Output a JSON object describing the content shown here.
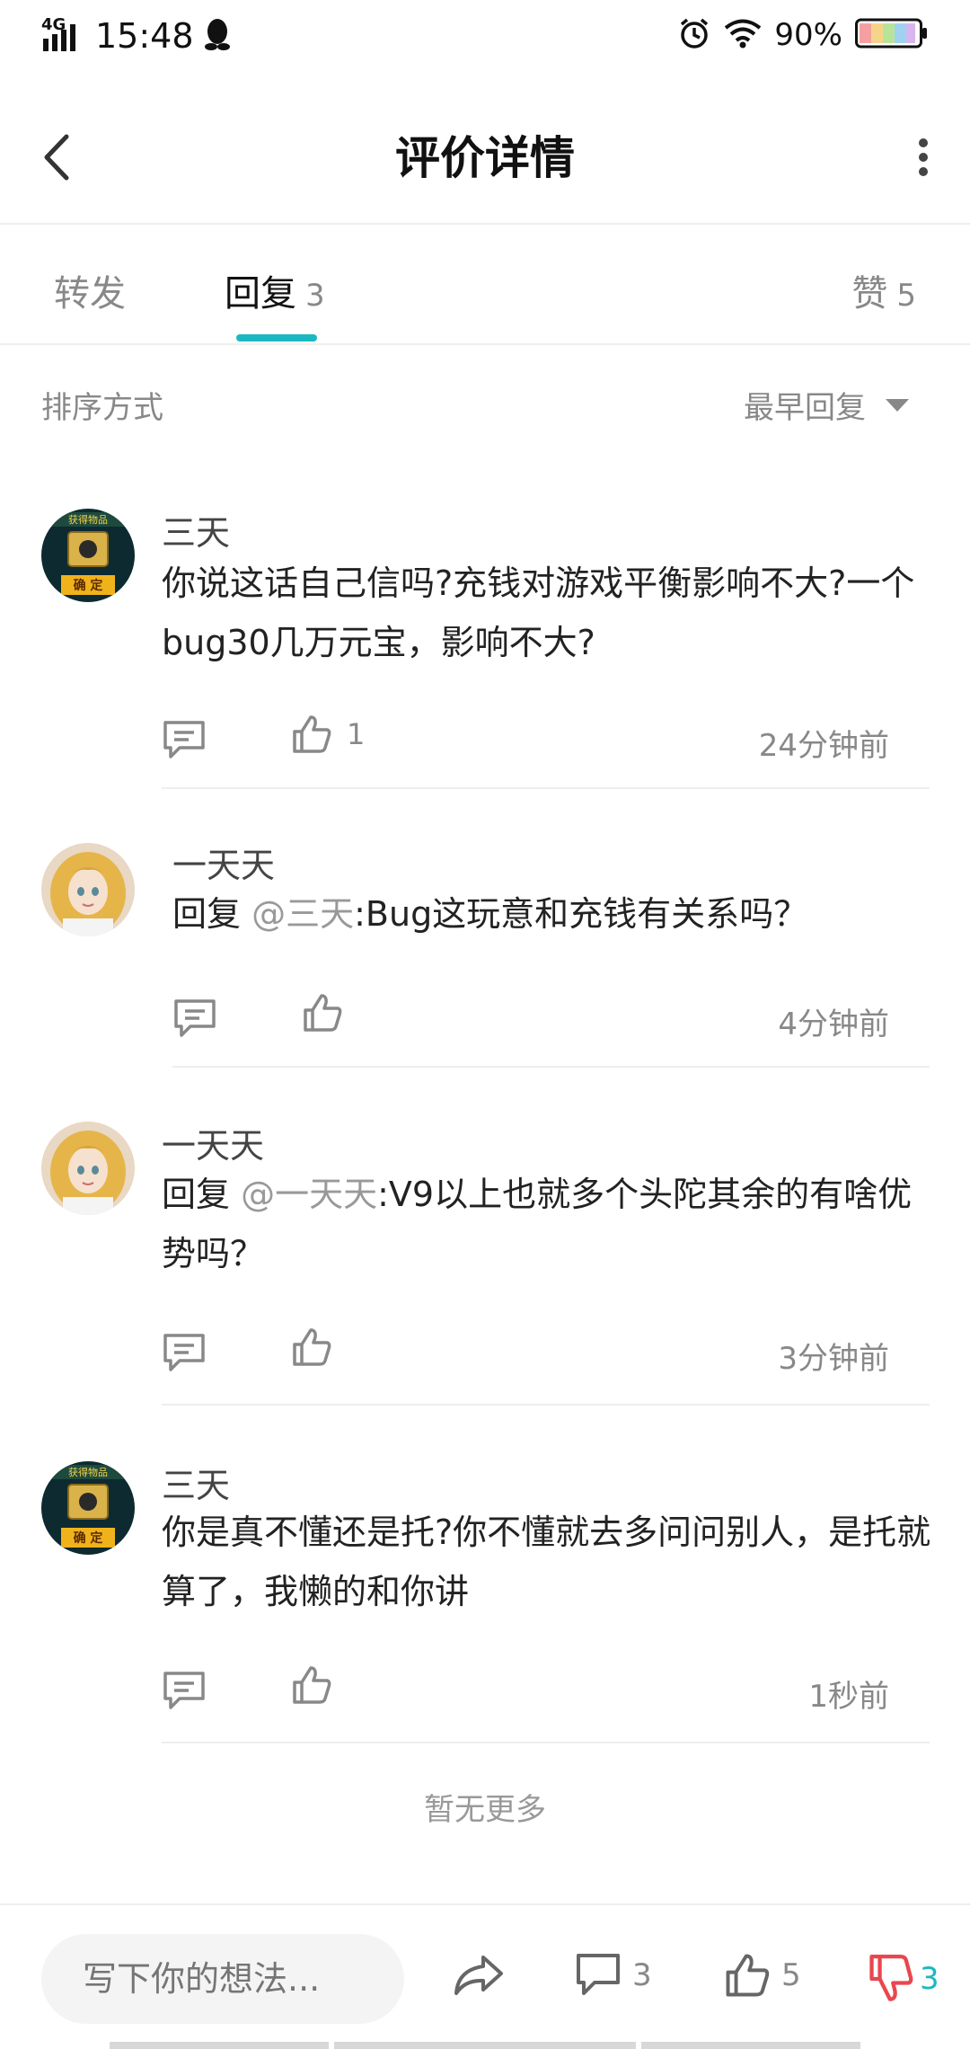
{
  "status_bar": {
    "network": "4G",
    "time": "15:48",
    "battery": "90%"
  },
  "nav": {
    "title": "评价详情"
  },
  "tabs": [
    {
      "label": "转发",
      "count": ""
    },
    {
      "label": "回复",
      "count": "3"
    },
    {
      "label": "赞",
      "count": "5"
    }
  ],
  "sort": {
    "label": "排序方式",
    "value": "最早回复"
  },
  "comments": [
    {
      "name": "三天",
      "avatar": "item-badge-avatar",
      "reply_prefix": "",
      "mention": "",
      "text": "你说这话自己信吗?充钱对游戏平衡影响不大?一个bug30几万元宝，影响不大?",
      "likes": "1",
      "time": "24分钟前"
    },
    {
      "name": "一天天",
      "avatar": "anime-girl-avatar",
      "reply_prefix": "回复 ",
      "mention": "@三天",
      "text": ":Bug这玩意和充钱有关系吗？",
      "likes": "",
      "time": "4分钟前"
    },
    {
      "name": "一天天",
      "avatar": "anime-girl-avatar",
      "reply_prefix": "回复 ",
      "mention": "@一天天",
      "text": ":V9以上也就多个头陀其余的有啥优势吗？",
      "likes": "",
      "time": "3分钟前"
    },
    {
      "name": "三天",
      "avatar": "item-badge-avatar",
      "reply_prefix": "",
      "mention": "",
      "text": "你是真不懂还是托?你不懂就去多问问别人，是托就算了，我懒的和你讲",
      "likes": "",
      "time": "1秒前"
    }
  ],
  "avatar_badge": {
    "top": "获得物品",
    "bottom": "确 定"
  },
  "footer": {
    "no_more": "暂无更多"
  },
  "bottom_bar": {
    "input_placeholder": "写下你的想法...",
    "comment_count": "3",
    "like_count": "5",
    "dislike_count": "3"
  },
  "colors": {
    "accent": "#1bb8c2",
    "dislike": "#e8474f",
    "secondary_text": "#888888"
  }
}
